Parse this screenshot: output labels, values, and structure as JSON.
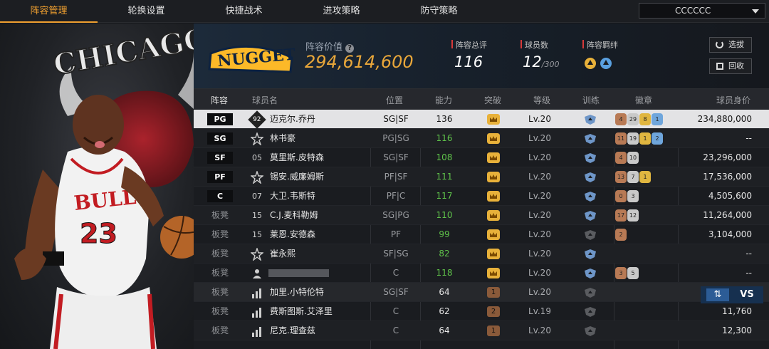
{
  "tabs": [
    {
      "label": "阵容管理",
      "active": true
    },
    {
      "label": "轮换设置",
      "active": false
    },
    {
      "label": "快捷战术",
      "active": false
    },
    {
      "label": "进攻策略",
      "active": false
    },
    {
      "label": "防守策略",
      "active": false
    }
  ],
  "team_select": {
    "value": "CCCCCC"
  },
  "art": {
    "team_text": "CHICAGO BULLS",
    "jersey_team": "BULLS",
    "jersey_number": "23"
  },
  "summary": {
    "logo_text": "NUGGETS",
    "value_label": "阵容价值",
    "value": "294,614,600",
    "rating_label": "阵容总评",
    "rating": "116",
    "players_label": "球员数",
    "players": "12",
    "players_max": "/300",
    "bond_label": "阵容羁绊",
    "btn_sign": "选拔",
    "btn_recycle": "回收"
  },
  "columns": [
    "阵容",
    "球员名",
    "位置",
    "能力",
    "突破",
    "等级",
    "训练",
    "徽章",
    "球员身价"
  ],
  "rows": [
    {
      "slot": "PG",
      "bench": false,
      "badge": "92",
      "name": "迈克尔.乔丹",
      "position": "SG|SF",
      "ability": "136",
      "ability_color": "#111111",
      "breakthrough": "",
      "level": "Lv.20",
      "hexes": [
        "4",
        "29",
        "8",
        "1"
      ],
      "value": "234,880,000"
    },
    {
      "slot": "SG",
      "bench": false,
      "badge": "star",
      "name": "林书豪",
      "position": "PG|SG",
      "ability": "116",
      "ability_color": "#5fc24a",
      "breakthrough": "",
      "level": "Lv.20",
      "hexes": [
        "11",
        "19",
        "1",
        "2"
      ],
      "value": "--"
    },
    {
      "slot": "SF",
      "bench": false,
      "badge": "05",
      "name": "莫里斯.皮特森",
      "position": "SG|SF",
      "ability": "108",
      "ability_color": "#5fc24a",
      "breakthrough": "",
      "level": "Lv.20",
      "hexes": [
        "4",
        "10"
      ],
      "value": "23,296,000"
    },
    {
      "slot": "PF",
      "bench": false,
      "badge": "star",
      "name": "锡安.威廉姆斯",
      "position": "PF|SF",
      "ability": "111",
      "ability_color": "#5fc24a",
      "breakthrough": "",
      "level": "Lv.20",
      "hexes": [
        "13",
        "7",
        "1"
      ],
      "value": "17,536,000"
    },
    {
      "slot": "C",
      "bench": false,
      "badge": "07",
      "name": "大卫.韦斯特",
      "position": "PF|C",
      "ability": "117",
      "ability_color": "#5fc24a",
      "breakthrough": "",
      "level": "Lv.20",
      "hexes": [
        "0",
        "3"
      ],
      "value": "4,505,600"
    },
    {
      "slot": "板凳",
      "bench": true,
      "badge": "15",
      "name": "C.J.麦科勒姆",
      "position": "SG|PG",
      "ability": "110",
      "ability_color": "#5fc24a",
      "breakthrough": "",
      "level": "Lv.20",
      "hexes": [
        "17",
        "12"
      ],
      "value": "11,264,000"
    },
    {
      "slot": "板凳",
      "bench": true,
      "badge": "15",
      "name": "莱恩.安德森",
      "position": "PF",
      "ability": "99",
      "ability_color": "#5fc24a",
      "breakthrough": "",
      "level": "Lv.20",
      "hexes": [
        "2"
      ],
      "value": "3,104,000"
    },
    {
      "slot": "板凳",
      "bench": true,
      "badge": "star",
      "name": "崔永熙",
      "position": "SF|SG",
      "ability": "82",
      "ability_color": "#5fc24a",
      "breakthrough": "",
      "level": "Lv.20",
      "hexes": [],
      "value": "--"
    },
    {
      "slot": "板凳",
      "bench": true,
      "badge": "person",
      "name": "",
      "position": "C",
      "ability": "118",
      "ability_color": "#5fc24a",
      "breakthrough": "",
      "level": "Lv.20",
      "hexes": [
        "3",
        "5"
      ],
      "value": "--"
    },
    {
      "slot": "板凳",
      "bench": true,
      "badge": "bars",
      "name": "加里.小特伦特",
      "position": "SG|SF",
      "ability": "64",
      "ability_color": "#e6e6e6",
      "breakthrough": "1",
      "level": "Lv.20",
      "hexes": [],
      "value": ""
    },
    {
      "slot": "板凳",
      "bench": true,
      "badge": "bars",
      "name": "费斯图斯.艾泽里",
      "position": "C",
      "ability": "62",
      "ability_color": "#e6e6e6",
      "breakthrough": "2",
      "level": "Lv.19",
      "hexes": [],
      "value": "11,760"
    },
    {
      "slot": "板凳",
      "bench": true,
      "badge": "bars",
      "name": "尼克.理查兹",
      "position": "C",
      "ability": "64",
      "ability_color": "#e6e6e6",
      "breakthrough": "1",
      "level": "Lv.20",
      "hexes": [],
      "value": "12,300"
    }
  ],
  "actions": {
    "vs_label": "VS"
  },
  "colors": {
    "accent": "#f0a030",
    "green": "#5fc24a",
    "gold": "#e8b13a",
    "shield": "#6e96c8"
  }
}
